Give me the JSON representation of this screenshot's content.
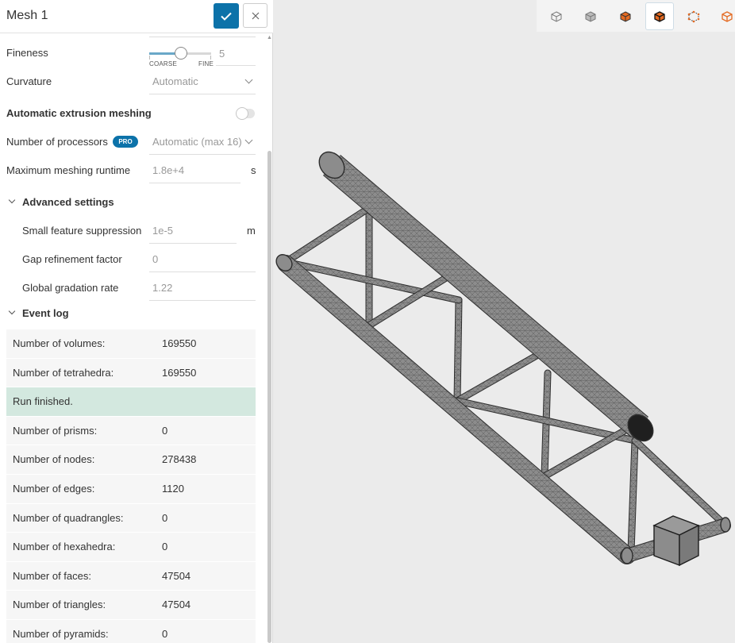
{
  "panel": {
    "title": "Mesh 1",
    "confirm_icon": "check-icon",
    "close_icon": "close-icon"
  },
  "settings": {
    "fineness": {
      "label": "Fineness",
      "value": "5",
      "level": 5,
      "min_label": "COARSE",
      "max_label": "FINE"
    },
    "curvature": {
      "label": "Curvature",
      "value": "Automatic"
    },
    "extrusion": {
      "label": "Automatic extrusion meshing",
      "enabled": false
    },
    "processors": {
      "label": "Number of processors",
      "badge": "PRO",
      "value": "Automatic (max 16)"
    },
    "runtime": {
      "label": "Maximum meshing runtime",
      "value": "1.8e+4",
      "unit": "s"
    }
  },
  "advanced": {
    "title": "Advanced settings",
    "small_feature": {
      "label": "Small feature suppression",
      "value": "1e-5",
      "unit": "m"
    },
    "gap_refinement": {
      "label": "Gap refinement factor",
      "value": "0"
    },
    "gradation": {
      "label": "Global gradation rate",
      "value": "1.22"
    }
  },
  "event_log": {
    "title": "Event log",
    "rows": [
      {
        "key": "Number of volumes:",
        "value": "169550"
      },
      {
        "key": "Number of tetrahedra:",
        "value": "169550"
      },
      {
        "key": "Run finished.",
        "value": "",
        "status": "finished"
      },
      {
        "key": "Number of prisms:",
        "value": "0"
      },
      {
        "key": "Number of nodes:",
        "value": "278438"
      },
      {
        "key": "Number of edges:",
        "value": "1120"
      },
      {
        "key": "Number of quadrangles:",
        "value": "0"
      },
      {
        "key": "Number of hexahedra:",
        "value": "0"
      },
      {
        "key": "Number of faces:",
        "value": "47504"
      },
      {
        "key": "Number of triangles:",
        "value": "47504"
      },
      {
        "key": "Number of pyramids:",
        "value": "0"
      }
    ]
  },
  "view_toolbar": {
    "buttons": [
      {
        "icon": "cube-wireframe-icon",
        "active": false
      },
      {
        "icon": "cube-shaded-icon",
        "active": false
      },
      {
        "icon": "cube-orange-solid-icon",
        "active": false
      },
      {
        "icon": "cube-orange-edges-icon",
        "active": true
      },
      {
        "icon": "cube-points-icon",
        "active": false
      },
      {
        "icon": "cube-orange-outline-icon",
        "active": false
      }
    ]
  },
  "colors": {
    "accent": "#0c72a9",
    "finished": "#d3e8df",
    "mesh": "#8a8a8a",
    "highlight": "#e46a22"
  }
}
